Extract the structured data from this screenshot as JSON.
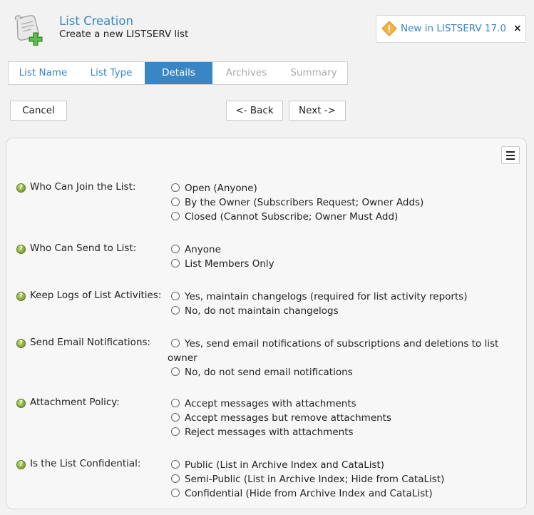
{
  "header": {
    "title": "List Creation",
    "subtitle": "Create a new LISTSERV list",
    "logo_icon": "scroll-plus-icon",
    "news_label": "New in LISTSERV 17.0",
    "news_icon": "warning-diamond-icon",
    "close_label": "×"
  },
  "colors": {
    "accent": "#3a86c4",
    "help": "#8cb43a",
    "warning": "#f0a030"
  },
  "tabs": [
    {
      "label": "List Name",
      "state": "link"
    },
    {
      "label": "List Type",
      "state": "link"
    },
    {
      "label": "Details",
      "state": "active"
    },
    {
      "label": "Archives",
      "state": "disabled"
    },
    {
      "label": "Summary",
      "state": "disabled"
    }
  ],
  "buttons": {
    "cancel": "Cancel",
    "back": "<- Back",
    "next": "Next ->"
  },
  "panel": {
    "menu_icon": "hamburger-menu-icon",
    "help_icon": "question-help-icon",
    "help_glyph": "?",
    "questions": [
      {
        "label": "Who Can Join the List:",
        "options": [
          "Open (Anyone)",
          "By the Owner (Subscribers Request; Owner Adds)",
          "Closed (Cannot Subscribe; Owner Must Add)"
        ]
      },
      {
        "label": "Who Can Send to List:",
        "options": [
          "Anyone",
          "List Members Only"
        ]
      },
      {
        "label": "Keep Logs of List Activities:",
        "options": [
          "Yes, maintain changelogs (required for list activity reports)",
          "No, do not maintain changelogs"
        ]
      },
      {
        "label": "Send Email Notifications:",
        "options": [
          "Yes, send email notifications of subscriptions and deletions to list owner",
          "No, do not send email notifications"
        ]
      },
      {
        "label": "Attachment Policy:",
        "options": [
          "Accept messages with attachments",
          "Accept messages but remove attachments",
          "Reject messages with attachments"
        ]
      },
      {
        "label": "Is the List Confidential:",
        "options": [
          "Public (List in Archive Index and CataList)",
          "Semi-Public (List in Archive Index; Hide from CataList)",
          "Confidential (Hide from Archive Index and CataList)"
        ]
      }
    ]
  }
}
